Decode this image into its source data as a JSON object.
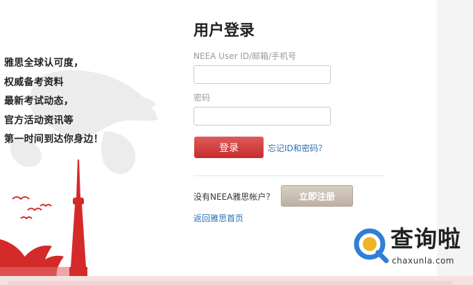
{
  "promo": {
    "lines": [
      "雅思全球认可度，",
      "权威备考资料",
      "最新考试动态，",
      "官方活动资讯等",
      "第一时间到达你身边！"
    ]
  },
  "login": {
    "title": "用户登录",
    "userid_label": "NEEA User ID/邮箱/手机号",
    "userid_value": "",
    "password_label": "密码",
    "password_value": "",
    "login_button": "登录",
    "forgot_link": "忘记ID和密码？",
    "no_account_text": "没有NEEA雅思帐户？",
    "register_button": "立即注册",
    "home_link": "返回雅思首页"
  },
  "watermark": {
    "main": "查询啦",
    "sub": "chaxunla.com",
    "logo_icon": "q-search-icon"
  },
  "colors": {
    "login_button": "#d64545",
    "register_button": "#c9bdb0",
    "link": "#2a6fb5",
    "accent_red": "#d42a2a",
    "watermark_blue": "#2f7fd8"
  }
}
